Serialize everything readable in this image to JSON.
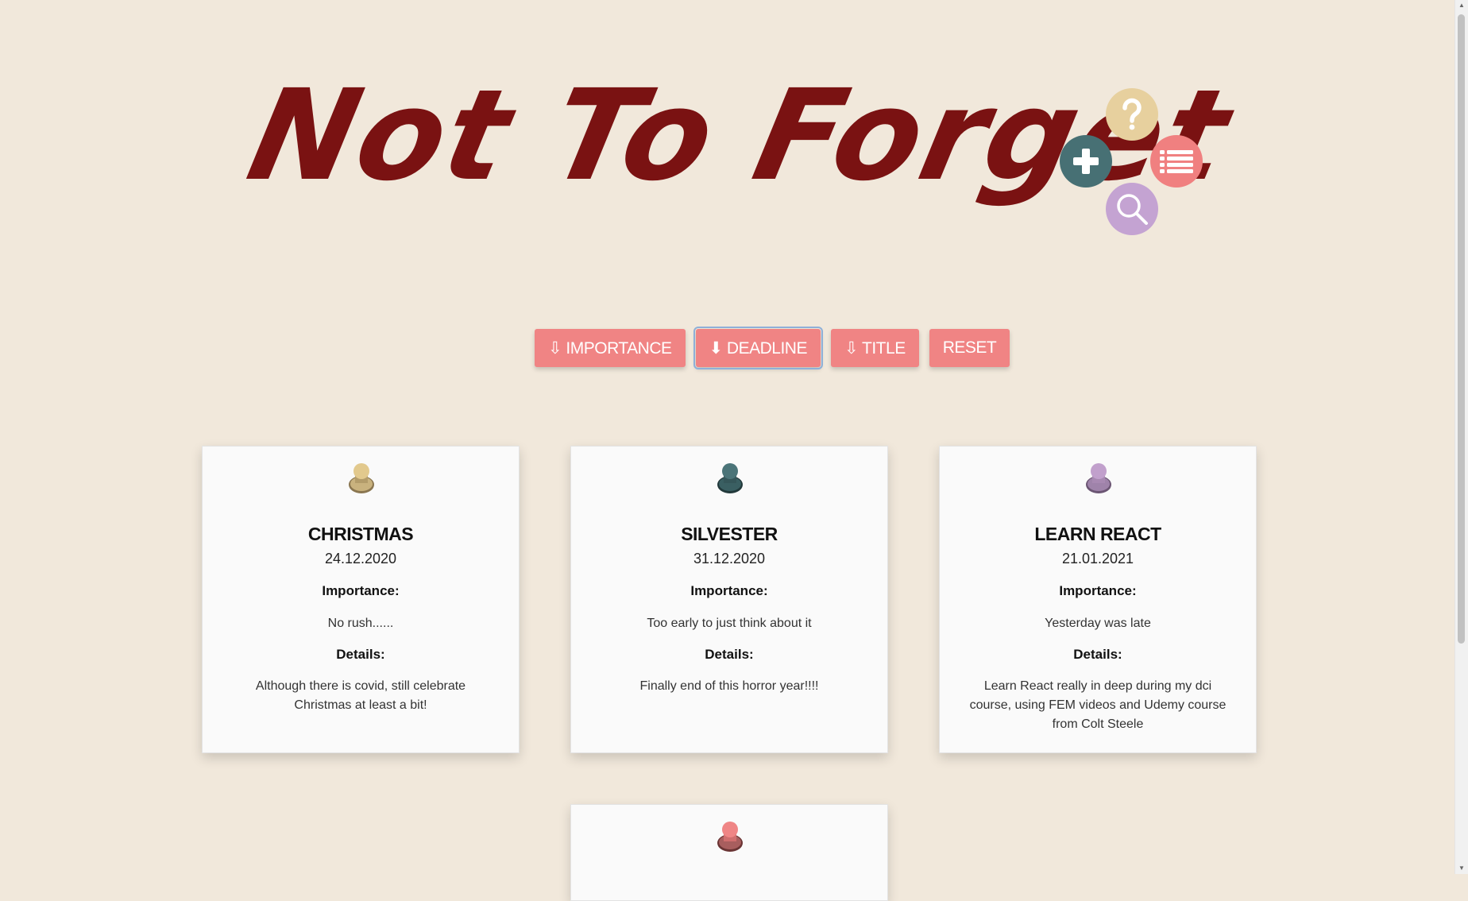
{
  "header": {
    "logo_text": "Not To Forget"
  },
  "menu": {
    "icons": [
      "question-mark-icon",
      "plus-icon",
      "list-icon",
      "magnifier-icon"
    ]
  },
  "sort_buttons": [
    {
      "label": "⇩ IMPORTANCE",
      "active": false
    },
    {
      "label": "⬇ DEADLINE",
      "active": true
    },
    {
      "label": "⇩ TITLE",
      "active": false
    },
    {
      "label": "RESET",
      "active": false
    }
  ],
  "cards": [
    {
      "title": "CHRISTMAS",
      "date": "24.12.2020",
      "importance_label": "Importance:",
      "importance": "No rush......",
      "details_label": "Details:",
      "details": "Although there is covid, still celebrate Christmas at least a bit!",
      "pin_color": "#e2c98d"
    },
    {
      "title": "SILVESTER",
      "date": "31.12.2020",
      "importance_label": "Importance:",
      "importance": "Too early to just think about it",
      "details_label": "Details:",
      "details": "Finally end of this horror year!!!!",
      "pin_color": "#4b7478"
    },
    {
      "title": "LEARN REACT",
      "date": "21.01.2021",
      "importance_label": "Importance:",
      "importance": "Yesterday was late",
      "details_label": "Details:",
      "details": "Learn React really in deep during my dci course, using FEM videos and Udemy course from Colt Steele",
      "pin_color": "#c1a0cc"
    },
    {
      "pin_color": "#ef8585"
    }
  ],
  "colors": {
    "background": "#f1e8db",
    "logo": "#7a1212",
    "button": "#f08484",
    "help": "#e7d09e",
    "add": "#477074",
    "list": "#f08080",
    "search": "#c4a3d2"
  }
}
